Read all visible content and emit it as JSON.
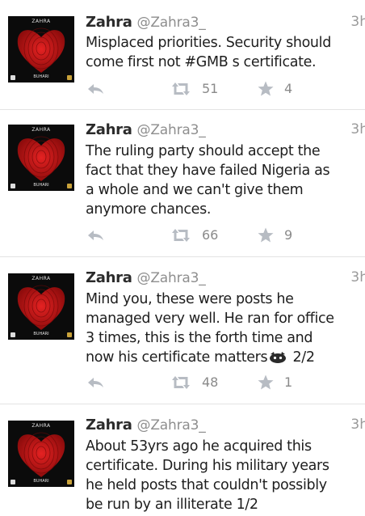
{
  "avatar": {
    "top_text": "ZAHRA",
    "bottom_text": "BUHARI",
    "colors": {
      "background": "#0b0b0b",
      "heart": "#c81a1a"
    }
  },
  "icons": {
    "reply": "reply-icon",
    "retweet": "retweet-icon",
    "favorite": "star-icon"
  },
  "colors": {
    "icon": "#b7bcc3",
    "count": "#8a8a8a",
    "divider": "#e3e3e3"
  },
  "tweets": [
    {
      "name": "Zahra",
      "handle": "@Zahra3_",
      "time": "3h",
      "text": "Misplaced priorities. Security should\ncome first not #GMB s certificate.",
      "retweets": "51",
      "favorites": "4"
    },
    {
      "name": "Zahra",
      "handle": "@Zahra3_",
      "time": "3h",
      "text": "The ruling party should accept the\nfact that they have failed Nigeria as\na whole and we can't give them\nanymore chances.",
      "retweets": "66",
      "favorites": "9"
    },
    {
      "name": "Zahra",
      "handle": "@Zahra3_",
      "time": "3h",
      "text": "Mind you, these were posts he\nmanaged very well. He ran for office\n3 times, this is the forth time and\nnow his certificate matters",
      "text_suffix": "2/2",
      "retweets": "48",
      "favorites": "1"
    },
    {
      "name": "Zahra",
      "handle": "@Zahra3_",
      "time": "3h",
      "text": "About 53yrs ago he acquired this\ncertificate. During his military years\nhe held posts that couldn't possibly\nbe run by an illiterate 1/2"
    }
  ]
}
